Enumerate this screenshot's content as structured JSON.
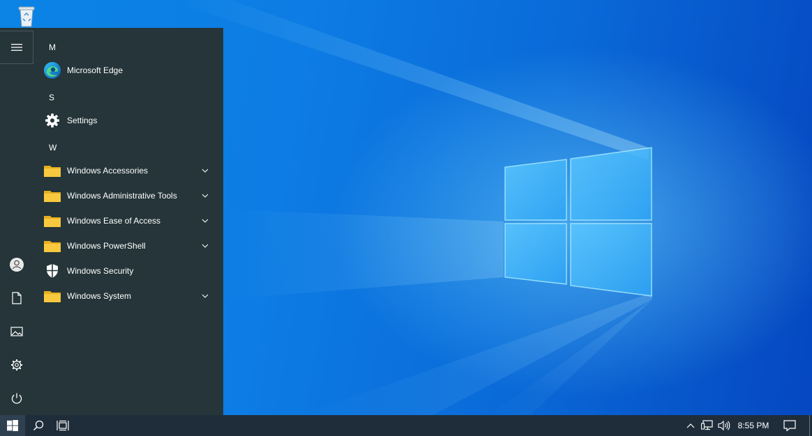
{
  "desktop": {
    "icons": [
      {
        "name": "recycle-bin-icon"
      }
    ]
  },
  "start_menu": {
    "rail": [
      {
        "icon": "hamburger-menu-icon"
      },
      {
        "icon": "user-account-icon"
      },
      {
        "icon": "documents-icon"
      },
      {
        "icon": "pictures-icon"
      },
      {
        "icon": "settings-gear-icon"
      },
      {
        "icon": "power-icon"
      }
    ],
    "groups": [
      {
        "letter": "M",
        "apps": [
          {
            "label": "Microsoft Edge",
            "icon": "edge-icon",
            "expandable": false
          }
        ]
      },
      {
        "letter": "S",
        "apps": [
          {
            "label": "Settings",
            "icon": "settings-gear-icon",
            "expandable": false
          }
        ]
      },
      {
        "letter": "W",
        "apps": [
          {
            "label": "Windows Accessories",
            "icon": "folder-icon",
            "expandable": true
          },
          {
            "label": "Windows Administrative Tools",
            "icon": "folder-icon",
            "expandable": true
          },
          {
            "label": "Windows Ease of Access",
            "icon": "folder-icon",
            "expandable": true
          },
          {
            "label": "Windows PowerShell",
            "icon": "folder-icon",
            "expandable": true
          },
          {
            "label": "Windows Security",
            "icon": "shield-icon",
            "expandable": false
          },
          {
            "label": "Windows System",
            "icon": "folder-icon",
            "expandable": true
          }
        ]
      }
    ]
  },
  "taskbar": {
    "buttons": [
      {
        "icon": "windows-logo-icon"
      },
      {
        "icon": "search-icon"
      },
      {
        "icon": "task-view-icon"
      }
    ],
    "tray": [
      {
        "icon": "chevron-up-icon"
      },
      {
        "icon": "network-icon"
      },
      {
        "icon": "volume-icon"
      }
    ],
    "clock": "8:55 PM",
    "notifications_icon": "action-center-icon"
  },
  "colors": {
    "start_menu_bg": "#253539",
    "taskbar_bg": "#1f2d3b",
    "folder_yellow": "#f5c43a",
    "accent_blue": "#0b84e6"
  }
}
